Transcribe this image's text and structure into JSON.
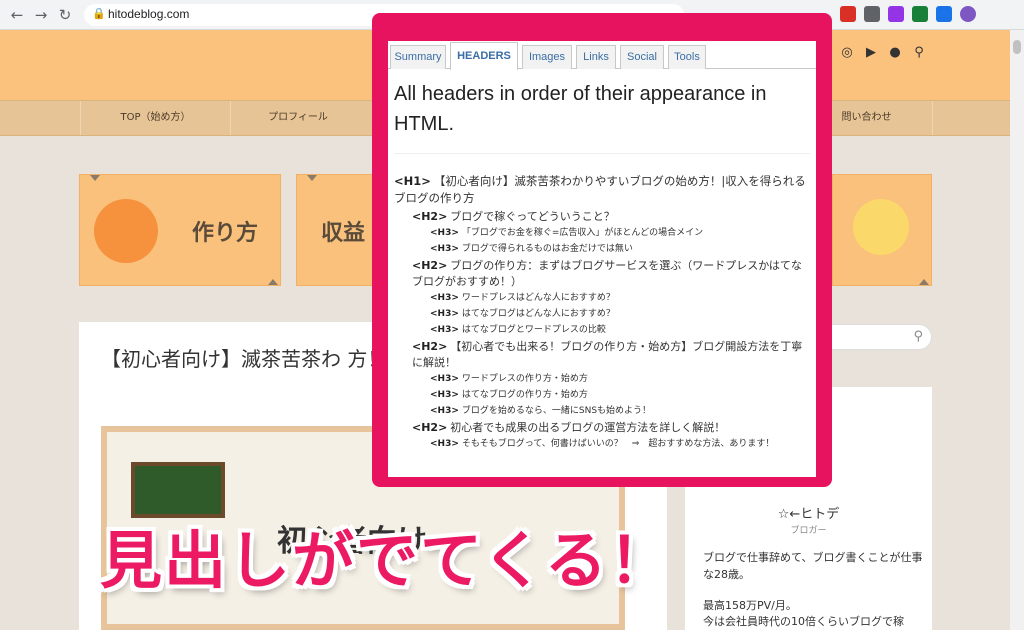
{
  "browser": {
    "url": "hitodeblog.com",
    "back_icon": "←",
    "forward_icon": "→",
    "reload_icon": "↻"
  },
  "site": {
    "nav": [
      "TOP（始め方）",
      "プロフィール",
      "問い合わせ"
    ],
    "categories": [
      {
        "label": "作り方"
      },
      {
        "label": "収益"
      }
    ]
  },
  "article": {
    "title": "【初心者向け】滅茶苦茶わ 方！|収入を得られるブログ",
    "eyecatch_text": "初心者向け"
  },
  "sidebar": {
    "name": "☆←ヒトデ",
    "role": "ブロガー",
    "desc": "ブログで仕事辞めて、ブログ書くことが仕事な28歳。",
    "stat1": "最高158万PV/月。",
    "stat2": "今は会社員時代の10倍くらいブログで稼"
  },
  "popup": {
    "tabs": [
      "Summary",
      "HEADERS",
      "Images",
      "Links",
      "Social",
      "Tools"
    ],
    "active_tab": "HEADERS",
    "heading": "All headers in order of their appearance in HTML.",
    "headers": [
      {
        "level": "H1",
        "text": "【初心者向け】滅茶苦茶わかりやすいブログの始め方！|収入を得られるブログの作り方"
      },
      {
        "level": "H2",
        "text": "ブログで稼ぐってどういうこと？"
      },
      {
        "level": "H3",
        "text": "「ブログでお金を稼ぐ=広告収入」がほとんどの場合メイン"
      },
      {
        "level": "H3",
        "text": "ブログで得られるものはお金だけでは無い"
      },
      {
        "level": "H2",
        "text": "ブログの作り方：まずはブログサービスを選ぶ（ワードプレスかはてなブログがおすすめ！）"
      },
      {
        "level": "H3",
        "text": "ワードプレスはどんな人におすすめ？"
      },
      {
        "level": "H3",
        "text": "はてなブログはどんな人におすすめ？"
      },
      {
        "level": "H3",
        "text": "はてなブログとワードプレスの比較"
      },
      {
        "level": "H2",
        "text": "【初心者でも出来る！ブログの作り方・始め方】ブログ開設方法を丁寧に解説！"
      },
      {
        "level": "H3",
        "text": "ワードプレスの作り方・始め方"
      },
      {
        "level": "H3",
        "text": "はてなブログの作り方・始め方"
      },
      {
        "level": "H3",
        "text": "ブログを始めるなら、一緒にSNSも始めよう！"
      },
      {
        "level": "H2",
        "text": "初心者でも成果の出るブログの運営方法を詳しく解説！"
      },
      {
        "level": "H3",
        "text": "そもそもブログって、何書けばいいの？　⇒　超おすすめな方法、あります！"
      }
    ]
  },
  "caption": "見出しがでてくる！",
  "colors": {
    "accent": "#e8135f",
    "header_bg": "#fbc27e",
    "nav_bg": "#e6c495"
  }
}
